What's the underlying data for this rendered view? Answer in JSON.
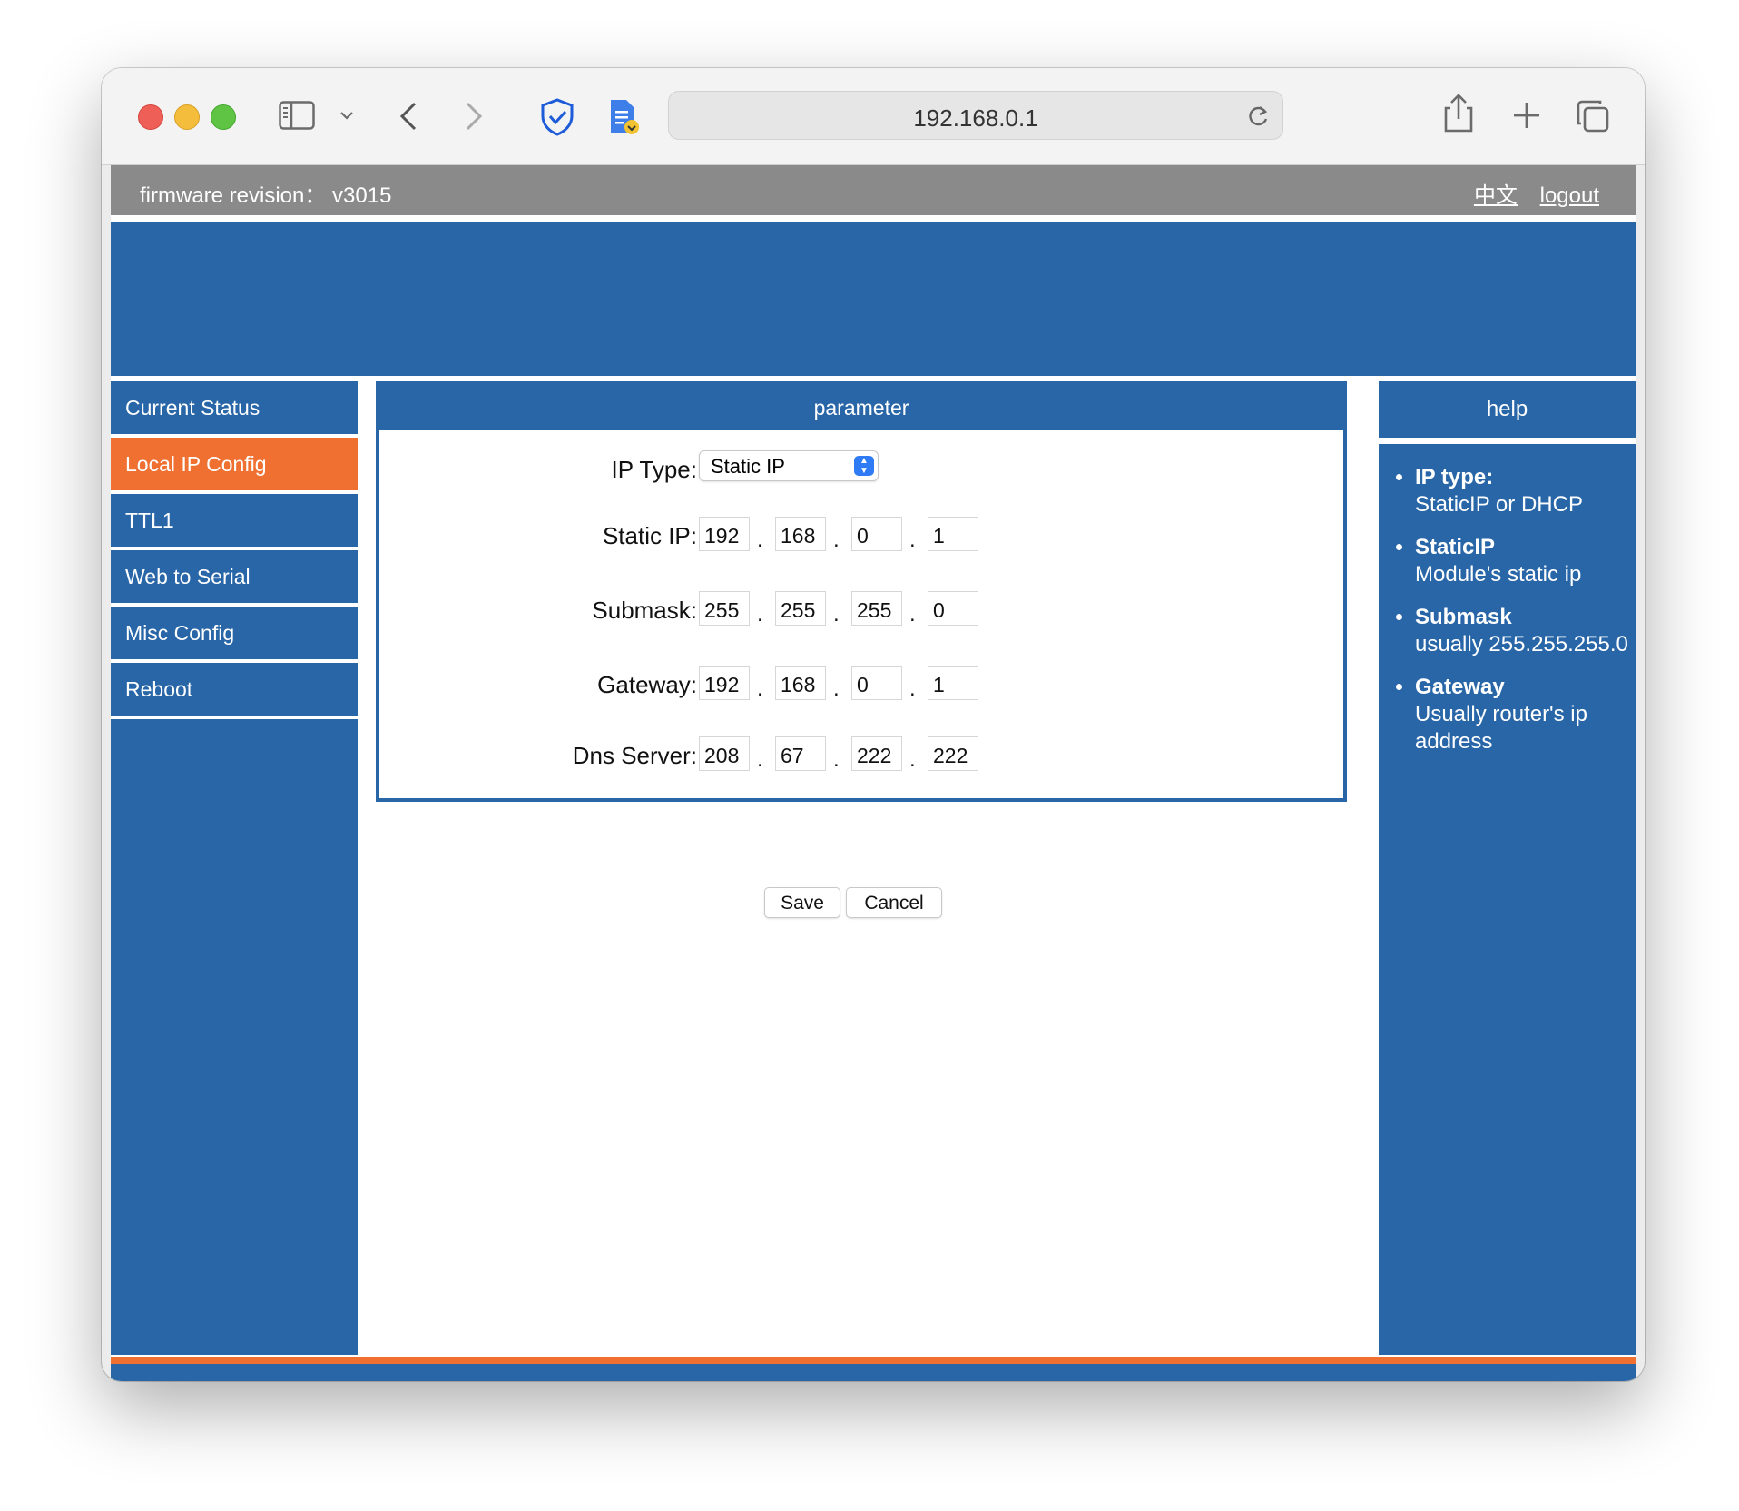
{
  "browser": {
    "url": "192.168.0.1"
  },
  "header": {
    "firmware": "firmware revision： v3015",
    "lang_link": "中文",
    "logout_link": "logout"
  },
  "sidebar": {
    "items": [
      {
        "label": "Current Status"
      },
      {
        "label": "Local IP Config"
      },
      {
        "label": "TTL1"
      },
      {
        "label": "Web to Serial"
      },
      {
        "label": "Misc Config"
      },
      {
        "label": "Reboot"
      }
    ]
  },
  "panel": {
    "title": "parameter",
    "ip_type": {
      "label": "IP Type:",
      "value": "Static IP"
    },
    "static_ip": {
      "label": "Static IP:",
      "octets": [
        "192",
        "168",
        "0",
        "1"
      ]
    },
    "submask": {
      "label": "Submask:",
      "octets": [
        "255",
        "255",
        "255",
        "0"
      ]
    },
    "gateway": {
      "label": "Gateway:",
      "octets": [
        "192",
        "168",
        "0",
        "1"
      ]
    },
    "dns": {
      "label": "Dns Server:",
      "octets": [
        "208",
        "67",
        "222",
        "222"
      ]
    },
    "dot": ".",
    "save_label": "Save",
    "cancel_label": "Cancel"
  },
  "help": {
    "title": "help",
    "items": [
      {
        "term": "IP type:",
        "desc": "StaticIP or DHCP"
      },
      {
        "term": "StaticIP",
        "desc": "Module's static ip"
      },
      {
        "term": "Submask",
        "desc": "usually 255.255.255.0"
      },
      {
        "term": "Gateway",
        "desc": "Usually router's ip address"
      }
    ]
  },
  "colors": {
    "primary_blue": "#2866a8",
    "accent_orange": "#f07032",
    "topbar_gray": "#8a8a8a"
  }
}
